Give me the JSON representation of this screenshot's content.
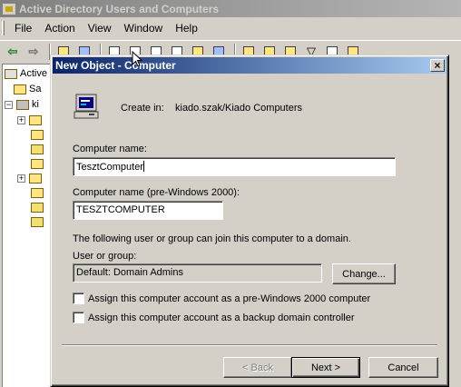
{
  "main_window": {
    "title": "Active Directory Users and Computers",
    "menu": [
      "File",
      "Action",
      "View",
      "Window",
      "Help"
    ],
    "tree_partial": [
      "Active",
      "Sa",
      "ki"
    ]
  },
  "dialog": {
    "title": "New Object - Computer",
    "close_glyph": "×",
    "create_in_label": "Create in:",
    "create_in_value": "kiado.szak/Kiado Computers",
    "computer_name_label": "Computer name:",
    "computer_name_value": "TesztComputer",
    "pre2000_label": "Computer name (pre-Windows 2000):",
    "pre2000_value": "TESZTCOMPUTER",
    "join_info": "The following user or group can join this computer to a domain.",
    "user_group_label": "User or group:",
    "user_group_value": "Default: Domain Admins",
    "change_button": "Change...",
    "checkbox_pre2000": "Assign this computer account as a pre-Windows 2000 computer",
    "checkbox_backup_dc": "Assign this computer account as a backup domain controller",
    "back_button": "< Back",
    "next_button": "Next >",
    "cancel_button": "Cancel"
  },
  "colors": {
    "dialog_title_start": "#0a246a",
    "dialog_title_end": "#a6caf0",
    "inactive_title": "#808080",
    "face": "#d4d0c8"
  },
  "icons": [
    "app-icon",
    "back-arrow-icon",
    "forward-arrow-icon",
    "computer-icon",
    "close-icon",
    "folder-icon",
    "mouse-cursor-icon"
  ]
}
